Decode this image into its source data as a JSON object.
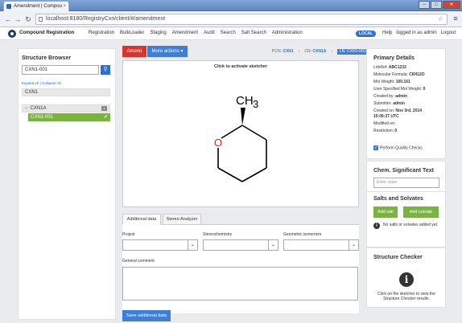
{
  "browser": {
    "tab_title": "Amendment | Compou",
    "tab_close": "×",
    "url": "localhost:8180/RegistryCxn/client/#/amendment",
    "win_controls": [
      "–",
      "□",
      "✕"
    ]
  },
  "header": {
    "brand": "Compound Registration",
    "nav": [
      "Registration",
      "BulkLoader",
      "Staging",
      "Amendment",
      "Audit",
      "Search",
      "Salt Search",
      "Administration"
    ],
    "badge": "LOCAL",
    "user_nav": [
      "Help",
      "logged in as admin",
      "Logout"
    ]
  },
  "structure_browser": {
    "title": "Structure Browser",
    "search_value": "CXN1-001",
    "expand_collapse": "Expand All | Collapse All",
    "root": "CXN1",
    "node": "CXN1A",
    "node_count": "1",
    "selected": "CXN1-001"
  },
  "toolbar": {
    "amend": "Amend",
    "more_actions": "More actions ▾",
    "crumb_pcn_label": "PCN:",
    "crumb_pcn": "CXN1",
    "crumb_cn_label": "CN:",
    "crumb_cn": "CXN1A",
    "crumb_ln": "LN: CXN1-001"
  },
  "sketcher": {
    "hint": "Click to activate sketcher",
    "atom_o": "O",
    "atom_ch3": "CH",
    "atom_ch3_sub": "3"
  },
  "tabs": [
    "Additional data",
    "Stereo Analyzer"
  ],
  "form": {
    "project_label": "Project",
    "stereo_label": "Stereochemistry",
    "geo_label": "Geometric isomerism",
    "comment_label": "General comment",
    "save": "Save additional data"
  },
  "primary_details": {
    "title": "Primary Details",
    "rows": [
      {
        "label": "LnbRef:",
        "value": "ABC1232"
      },
      {
        "label": "Molecular Formula:",
        "value": "C6H12O"
      },
      {
        "label": "Mol Weight:",
        "value": "100.161"
      },
      {
        "label": "User Specified Mol Weight:",
        "value": "0"
      },
      {
        "label": "Created by:",
        "value": "admin"
      },
      {
        "label": "Submitter:",
        "value": "admin"
      },
      {
        "label": "Created on:",
        "value": "Nov 3rd, 2014"
      },
      {
        "label": "",
        "value": "15:06:27 UTC"
      },
      {
        "label": "Modified on:",
        "value": ""
      },
      {
        "label": "Restriction:",
        "value": "0"
      }
    ],
    "quality_checks": "Perform Quality Checks"
  },
  "chem_text": {
    "title": "Chem. Significant Text",
    "placeholder": "Enter value"
  },
  "salts": {
    "title": "Salts and Solvates",
    "add_salt": "Add salt",
    "add_solvate": "Add solvate",
    "note": "No salts or solvates added yet."
  },
  "checker": {
    "title": "Structure Checker",
    "text": "Click on the sketcher to view the Structure Checker results."
  },
  "colors": {
    "amend": "#d9342b",
    "primary": "#3f7ed6",
    "success": "#7ab43f"
  }
}
